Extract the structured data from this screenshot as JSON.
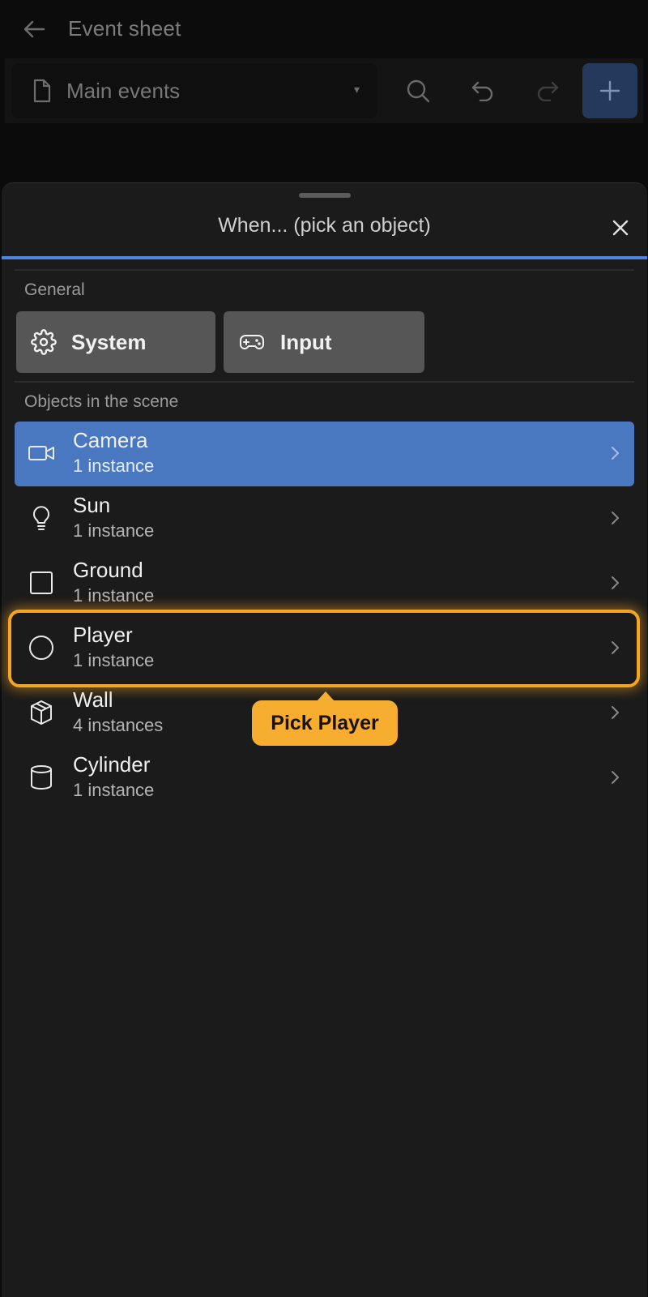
{
  "header": {
    "title": "Event sheet",
    "back_icon": "arrow-left-icon"
  },
  "toolbar": {
    "sheet_name": "Main events",
    "file_icon": "file-icon",
    "caret": "▾",
    "search_icon": "search-icon",
    "undo_icon": "undo-icon",
    "redo_icon": "redo-icon",
    "add_icon": "plus-icon"
  },
  "picker": {
    "title": "When... (pick an object)",
    "close_icon": "close-icon",
    "progress": 1.0,
    "accent_color": "#4c84e3",
    "general_label": "General",
    "categories": [
      {
        "label": "System",
        "icon": "gear-icon"
      },
      {
        "label": "Input",
        "icon": "gamepad-icon"
      }
    ],
    "objects_label": "Objects in the scene",
    "objects": [
      {
        "name": "Camera",
        "count": "1 instance",
        "icon": "camera-icon",
        "selected": true
      },
      {
        "name": "Sun",
        "count": "1 instance",
        "icon": "lightbulb-icon"
      },
      {
        "name": "Ground",
        "count": "1 instance",
        "icon": "square-icon"
      },
      {
        "name": "Player",
        "count": "1 instance",
        "icon": "circle-icon",
        "highlighted": true
      },
      {
        "name": "Wall",
        "count": "4 instances",
        "icon": "cube-icon"
      },
      {
        "name": "Cylinder",
        "count": "1 instance",
        "icon": "cylinder-icon"
      }
    ],
    "selected_color": "#4a78c0"
  },
  "tutorial": {
    "tooltip": "Pick Player",
    "highlight_color": "#f5a524"
  }
}
